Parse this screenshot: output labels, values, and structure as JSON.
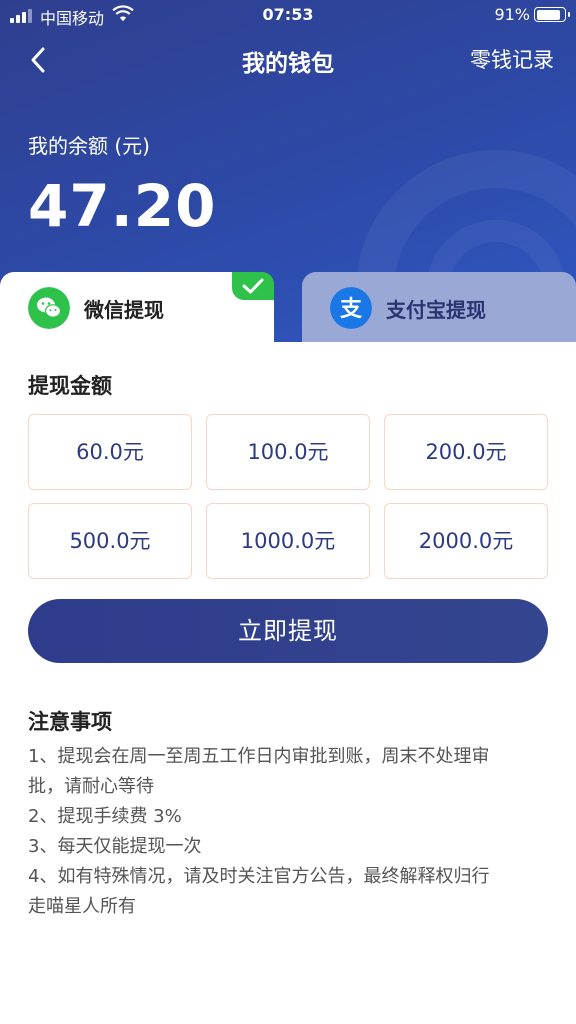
{
  "status_bar": {
    "carrier": "中国移动",
    "time": "07:53",
    "battery": "91%",
    "battery_level": 0.91
  },
  "nav": {
    "title": "我的钱包",
    "records_link": "零钱记录"
  },
  "balance": {
    "label": "我的余额 (元)",
    "value": "47.20"
  },
  "tabs": [
    {
      "label": "微信提现",
      "icon": "wechat-icon",
      "selected": true,
      "color": "#2fc24a"
    },
    {
      "label": "支付宝提现",
      "icon": "alipay-icon",
      "selected": false,
      "color": "#1a78e6"
    }
  ],
  "withdraw": {
    "section_title": "提现金额",
    "amounts": [
      "60.0元",
      "100.0元",
      "200.0元",
      "500.0元",
      "1000.0元",
      "2000.0元"
    ],
    "submit_label": "立即提现"
  },
  "notes": {
    "title": "注意事项",
    "lines": [
      "1、提现会在周一至周五工作日内审批到账，周末不处理审",
      "批，请耐心等待",
      "2、提现手续费 3%",
      "3、每天仅能提现一次",
      "4、如有特殊情况，请及时关注官方公告，最终解释权归行",
      "走喵星人所有"
    ]
  },
  "colors": {
    "header_bg": "#2d4aa8",
    "accent": "#2f3c8c",
    "amount_border": "#f7d6c8",
    "amount_text": "#2d3a85",
    "check_badge": "#2fc24a"
  }
}
